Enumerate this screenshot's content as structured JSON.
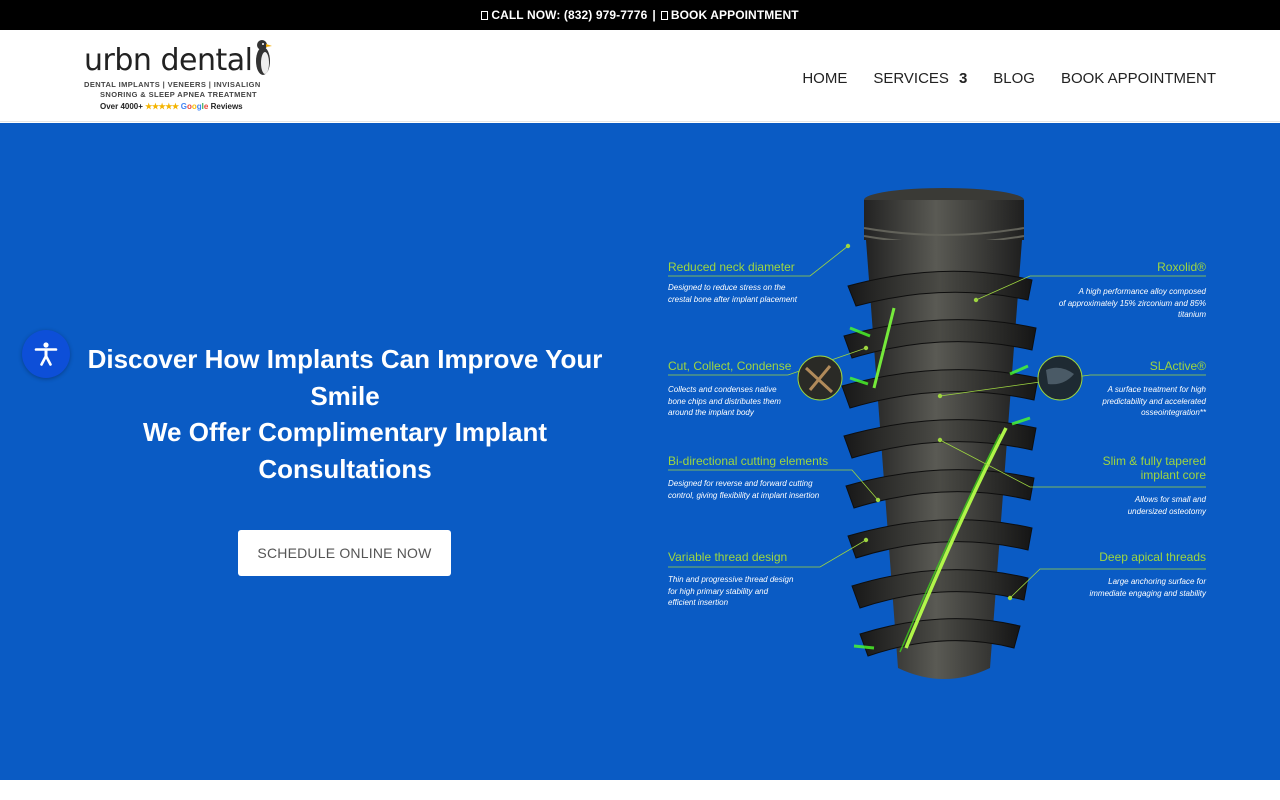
{
  "topbar": {
    "call_text": "CALL NOW: (832) 979-7776",
    "separator": "|",
    "book_text": "BOOK APPOINTMENT"
  },
  "logo": {
    "wordmark": "urbn dental",
    "tagline_1": "DENTAL IMPLANTS | VENEERS | INVISALIGN",
    "tagline_2": "SNORING & SLEEP APNEA TREATMENT",
    "reviews_prefix": "Over 4000+",
    "stars": "★★★★★",
    "reviews_suffix": "Reviews"
  },
  "nav": {
    "items": [
      {
        "label": "HOME"
      },
      {
        "label": "SERVICES",
        "caret": "3"
      },
      {
        "label": "BLOG"
      },
      {
        "label": "BOOK APPOINTMENT"
      }
    ]
  },
  "hero": {
    "title_line_1": "Discover How Implants Can Improve Your Smile",
    "title_line_2": "We Offer Complimentary Implant Consultations",
    "cta_label": "SCHEDULE ONLINE NOW",
    "background_color": "#0a5bc4"
  },
  "accessibility": {
    "icon": "accessibility-person-icon"
  },
  "implant_figure": {
    "label_color": "#9ed640",
    "callouts_left": [
      {
        "title": "Reduced neck diameter",
        "desc_1": "Designed to reduce stress on the",
        "desc_2": "crestal bone after implant placement",
        "desc_3": ""
      },
      {
        "title": "Cut, Collect, Condense",
        "desc_1": "Collects and condenses native",
        "desc_2": "bone chips and distributes them",
        "desc_3": "around the implant body"
      },
      {
        "title": "Bi-directional cutting elements",
        "desc_1": "Designed for reverse and forward cutting",
        "desc_2": "control, giving flexibility at implant insertion",
        "desc_3": ""
      },
      {
        "title": "Variable thread design",
        "desc_1": "Thin and progressive thread design",
        "desc_2": "for high primary stability and",
        "desc_3": "efficient insertion"
      }
    ],
    "callouts_right": [
      {
        "title": "Roxolid®",
        "title_2": "",
        "desc_1": "A high performance alloy composed",
        "desc_2": "of approximately 15% zirconium and 85%",
        "desc_3": "titanium"
      },
      {
        "title": "SLActive®",
        "title_2": "",
        "desc_1": "A surface treatment for high",
        "desc_2": "predictability and accelerated",
        "desc_3": "osseointegration**"
      },
      {
        "title": "Slim & fully tapered",
        "title_2": "implant core",
        "desc_1": "Allows for small and",
        "desc_2": "undersized osteotomy",
        "desc_3": ""
      },
      {
        "title": "Deep apical threads",
        "title_2": "",
        "desc_1": "Large anchoring surface for",
        "desc_2": "immediate engaging and stability",
        "desc_3": ""
      }
    ]
  }
}
